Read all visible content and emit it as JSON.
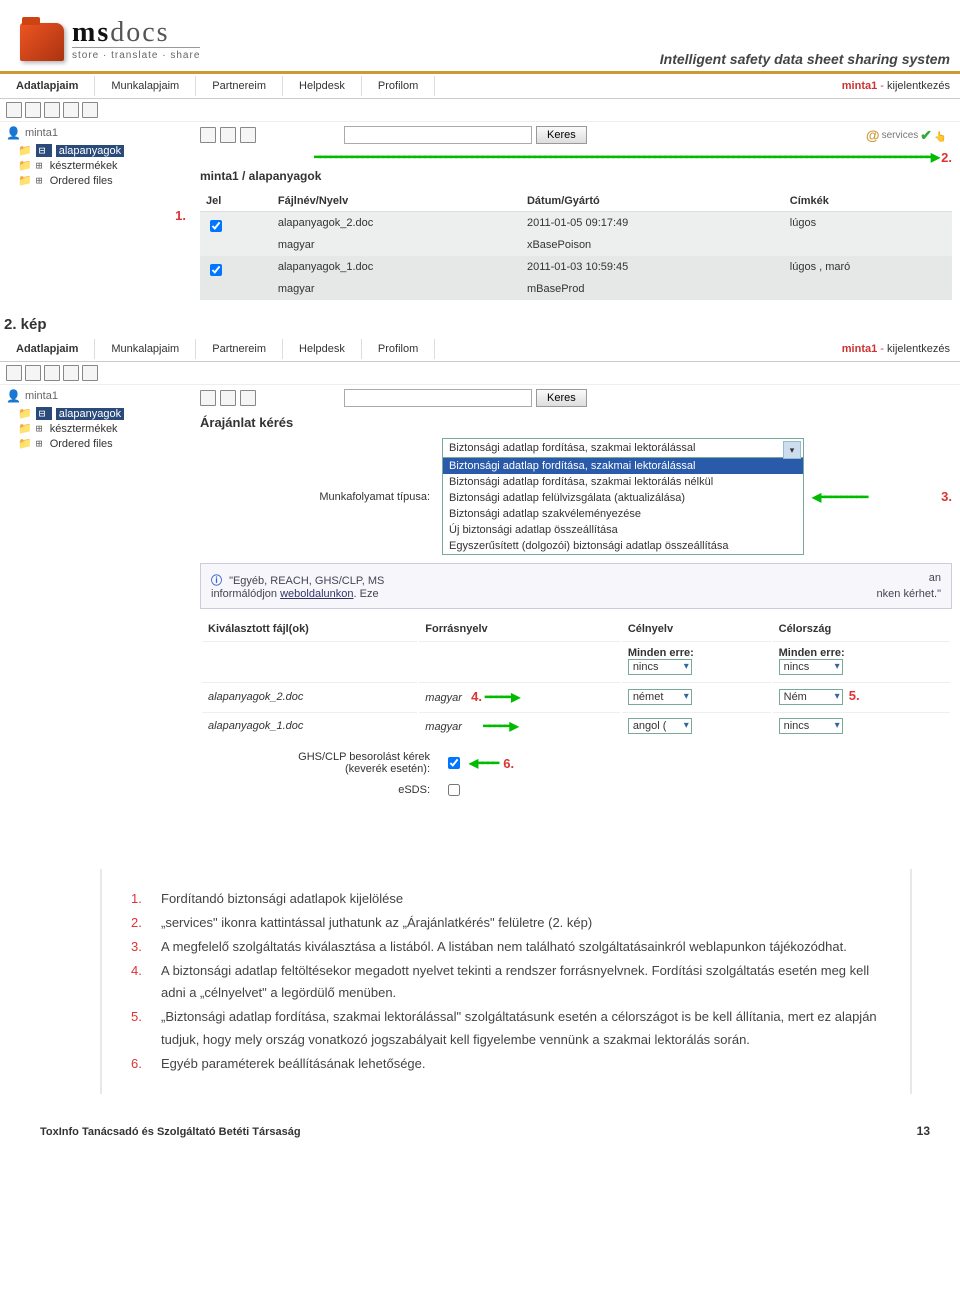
{
  "logo": {
    "brand_prefix": "ms",
    "brand_rest": "docs",
    "sub": "store · translate · share"
  },
  "tagline": "Intelligent safety data sheet sharing system",
  "tabs": [
    "Adatlapjaim",
    "Munkalapjaim",
    "Partnereim",
    "Helpdesk",
    "Profilom"
  ],
  "user": {
    "name": "minta1",
    "logout": "kijelentkezés"
  },
  "tree": {
    "user": "minta1",
    "items": [
      {
        "label": "alapanyagok",
        "sel": true
      },
      {
        "label": "késztermékek"
      },
      {
        "label": "Ordered files"
      }
    ]
  },
  "search": {
    "btn": "Keres",
    "svc": "services"
  },
  "breadcrumb": "minta1 / alapanyagok",
  "cols": {
    "jel": "Jel",
    "file": "Fájlnév/Nyelv",
    "date": "Dátum/Gyártó",
    "tags": "Címkék"
  },
  "rows": [
    {
      "file": "alapanyagok_2.doc",
      "lang": "magyar",
      "date": "2011-01-05 09:17:49",
      "mfr": "xBasePoison",
      "tags": "lúgos"
    },
    {
      "file": "alapanyagok_1.doc",
      "lang": "magyar",
      "date": "2011-01-03 10:59:45",
      "mfr": "mBaseProd",
      "tags": "lúgos , maró"
    }
  ],
  "callouts": {
    "c1": "1.",
    "c2": "2.",
    "c3": "3.",
    "c4": "4.",
    "c5": "5.",
    "c6": "6."
  },
  "kep": "2. kép",
  "quote_title": "Árajánlat kérés",
  "wf": {
    "label": "Munkafolyamat típusa:",
    "selected": "Biztonsági adatlap fordítása, szakmai lektorálással",
    "options": [
      "Biztonsági adatlap fordítása, szakmai lektorálással",
      "Biztonsági adatlap fordítása, szakmai lektorálás nélkül",
      "Biztonsági adatlap felülvizsgálata (aktualizálása)",
      "Biztonsági adatlap szakvéleményezése",
      "Új biztonsági adatlap összeállítása",
      "Egyszerűsített (dolgozói) biztonsági adatlap összeállítása"
    ]
  },
  "infobox": {
    "pre": "\"Egyéb, REACH, GHS/CLP, MS",
    "mid": " weboldalunkon",
    "suf": ". Eze",
    "tail": "nken kérhet.\"",
    "line2": "informálódjon"
  },
  "filecols": {
    "files": "Kiválasztott fájl(ok)",
    "src": "Forrásnyelv",
    "tgt": "Célnyelv",
    "country": "Célország",
    "all": "Minden erre:"
  },
  "selvals": {
    "none": "nincs",
    "german": "német",
    "english": "angol (",
    "ger": "Ném"
  },
  "filerows": [
    {
      "file": "alapanyagok_2.doc",
      "src": "magyar",
      "tgt": "german",
      "country": "ger"
    },
    {
      "file": "alapanyagok_1.doc",
      "src": "magyar",
      "tgt": "english",
      "country": "none"
    }
  ],
  "checks": {
    "ghs": "GHS/CLP besorolást kérek",
    "ghs2": "(keverék esetén):",
    "esds": "eSDS:"
  },
  "instructions": [
    "Fordítandó biztonsági adatlapok kijelölése",
    "„services\" ikonra kattintással juthatunk az „Árajánlatkérés\" felületre (2. kép)",
    "A megfelelő szolgáltatás kiválasztása a listából. A listában nem található szolgáltatásainkról weblapunkon tájékozódhat.",
    "A biztonsági adatlap feltöltésekor megadott nyelvet tekinti a rendszer forrásnyelvnek. Fordítási szolgáltatás esetén meg kell adni a „célnyelvet\" a legördülő menüben.",
    "„Biztonsági adatlap fordítása, szakmai lektorálással\" szolgáltatásunk esetén a célországot is be kell állítania, mert ez alapján tudjuk, hogy mely ország vonatkozó jogszabályait kell figyelembe vennünk a szakmai lektorálás során.",
    "Egyéb paraméterek beállításának lehetősége."
  ],
  "footer": {
    "company": "ToxInfo Tanácsadó és Szolgáltató Betéti Társaság",
    "page": "13"
  }
}
